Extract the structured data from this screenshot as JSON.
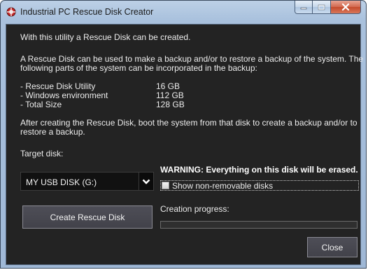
{
  "window": {
    "title": "Industrial PC Rescue Disk Creator"
  },
  "content": {
    "intro": "With this utility a Rescue Disk can be created.",
    "description_line1": "A Rescue Disk can be used to make a backup and/or to restore a backup of the system.  The",
    "description_line2": "following parts of the system can be incorporated in the backup:",
    "sizes": [
      {
        "label": "- Rescue Disk Utility",
        "value": "16 GB"
      },
      {
        "label": "- Windows environment",
        "value": "112 GB"
      },
      {
        "label": "- Total Size",
        "value": "128 GB"
      }
    ],
    "after_line1": "After creating the Rescue Disk, boot the system from that disk to create a backup and/or to",
    "after_line2": "restore a backup."
  },
  "target": {
    "label": "Target disk:",
    "selected": "MY USB DISK (G:)"
  },
  "warning": "WARNING:  Everything on this disk will be erased.",
  "show_nonremovable": {
    "label": "Show non-removable disks",
    "checked": false
  },
  "buttons": {
    "create": "Create Rescue Disk",
    "close": "Close"
  },
  "progress": {
    "label": "Creation progress:",
    "value": 0
  },
  "colors": {
    "background": "#232323",
    "text": "#ececec",
    "button": "#4a4a52"
  }
}
